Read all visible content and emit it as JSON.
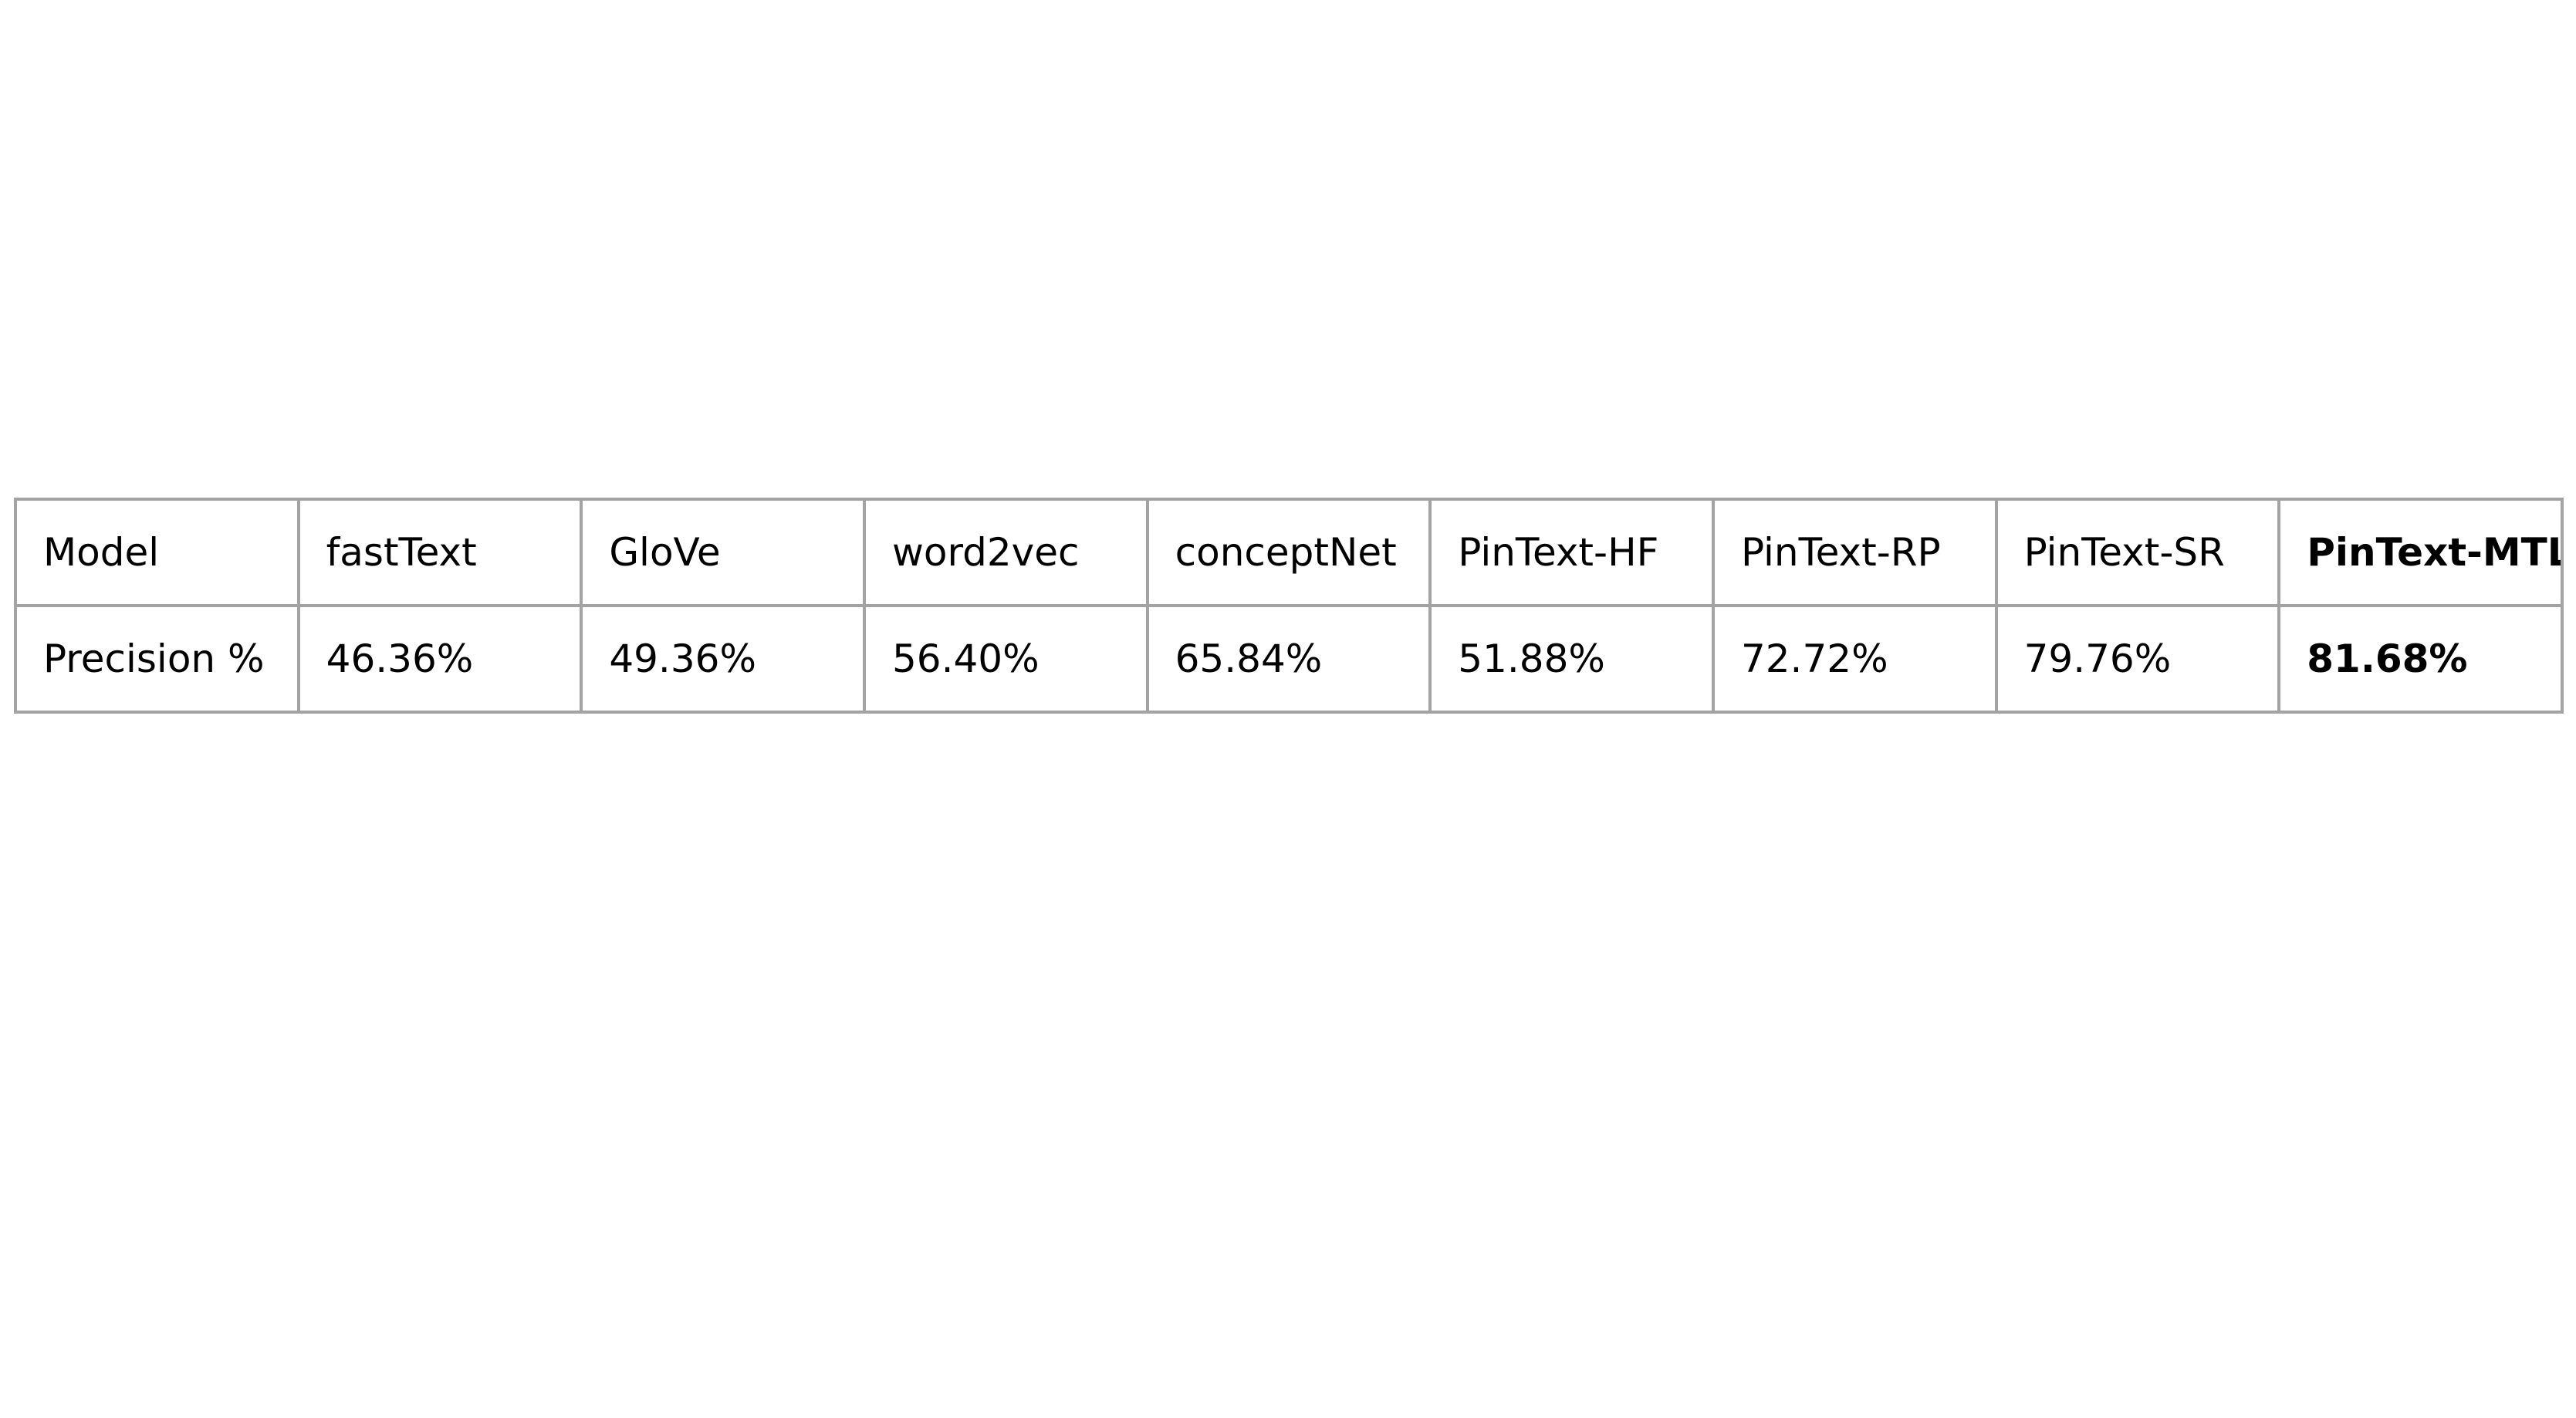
{
  "table": {
    "header_row": {
      "label": "Model",
      "cells": [
        "fastText",
        "GloVe",
        "word2vec",
        "conceptNet",
        "PinText-HF",
        "PinText-RP",
        "PinText-SR",
        "PinText-MTL"
      ]
    },
    "value_row": {
      "label": "Precision %",
      "cells": [
        "46.36%",
        "49.36%",
        "56.40%",
        "65.84%",
        "51.88%",
        "72.72%",
        "79.76%",
        "81.68%"
      ]
    },
    "highlighted_column": "PinText-MTL"
  }
}
